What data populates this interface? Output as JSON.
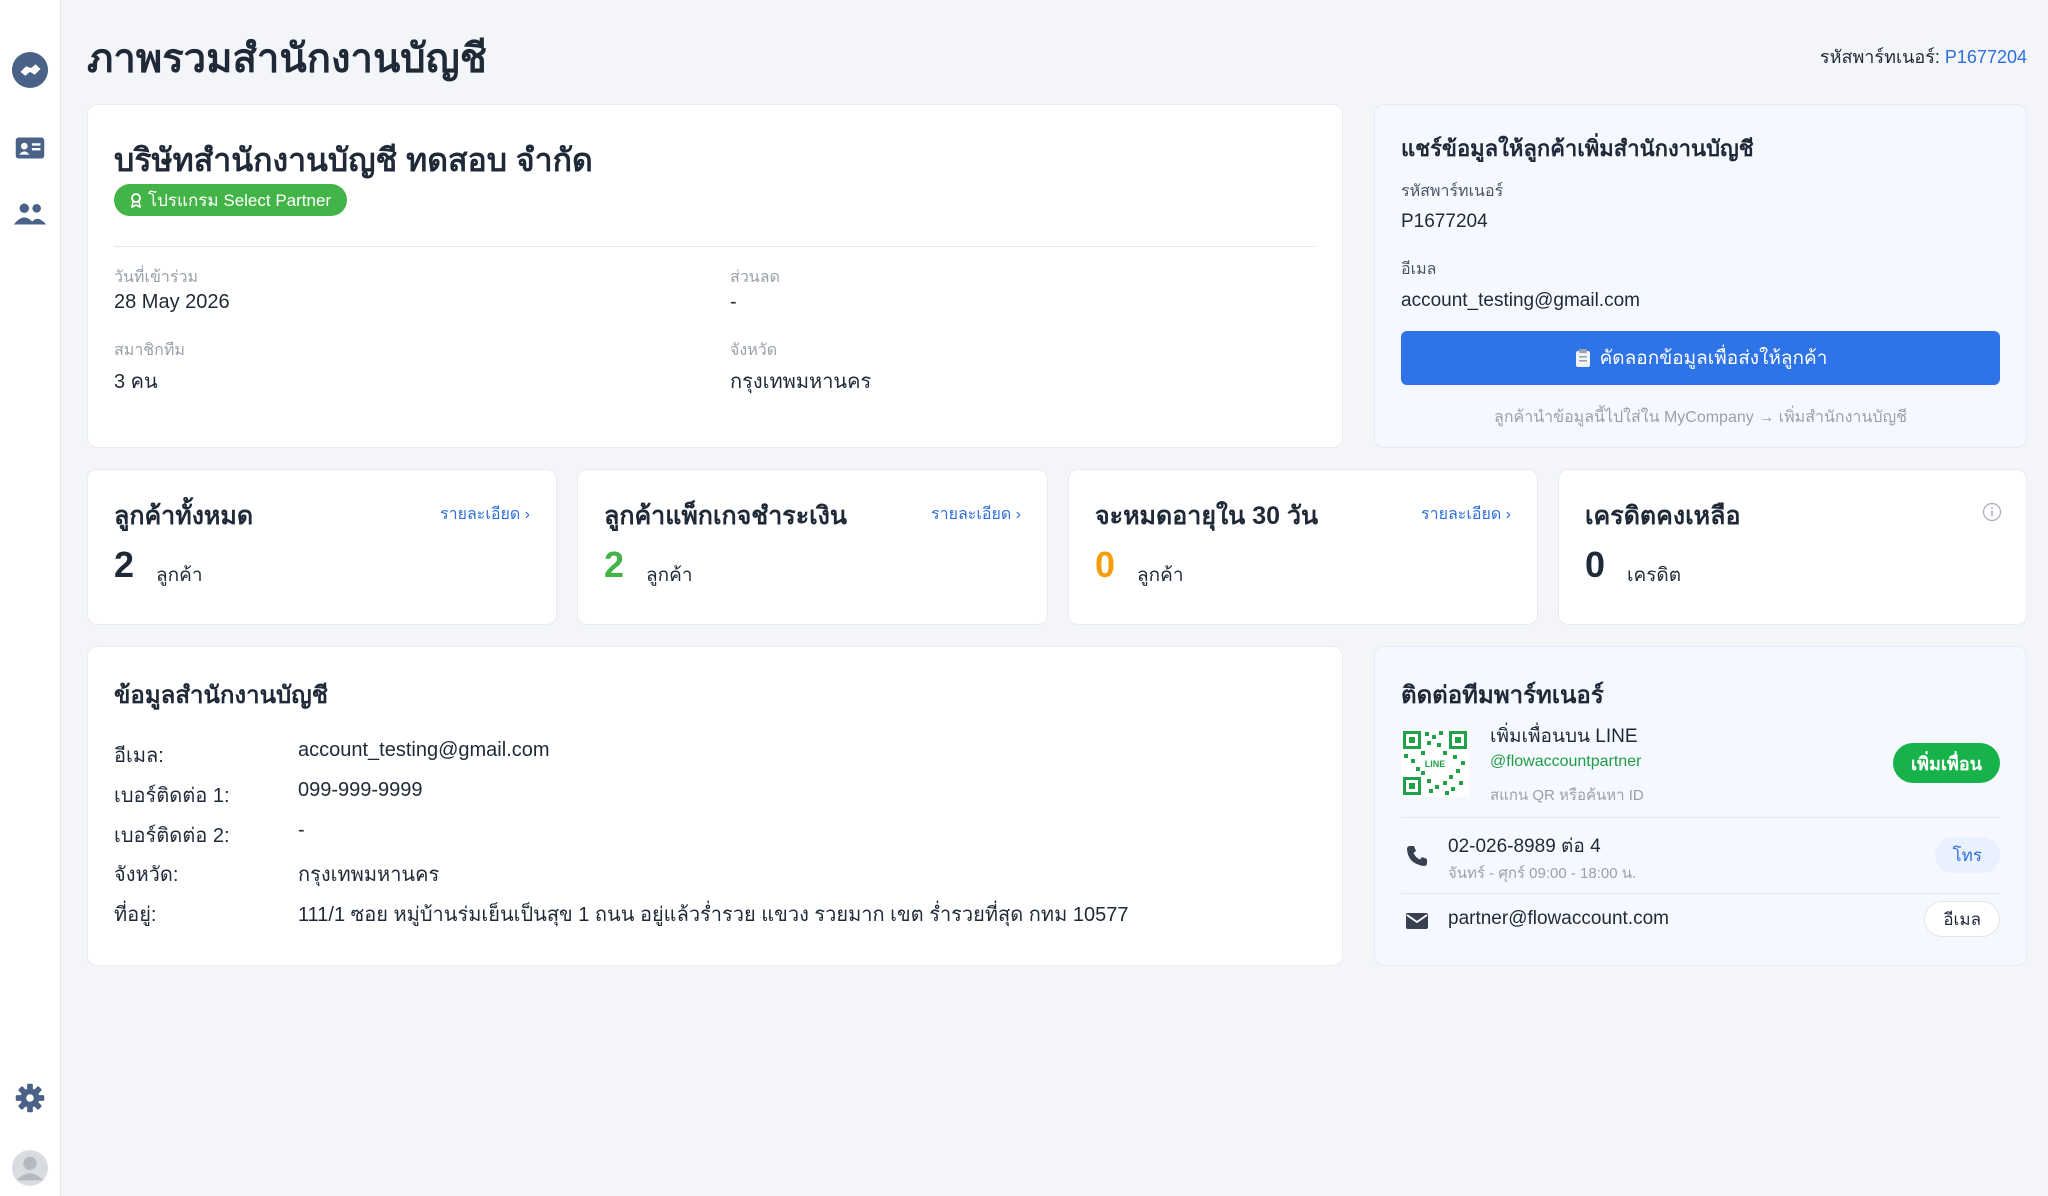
{
  "sidebar": {
    "items": [
      {
        "icon": "handshake-icon"
      },
      {
        "icon": "contact-card-icon"
      },
      {
        "icon": "users-icon"
      }
    ],
    "bottom": [
      {
        "icon": "gear-icon"
      },
      {
        "icon": "avatar-icon"
      }
    ]
  },
  "header": {
    "title": "ภาพรวมสำนักงานบัญชี",
    "partner_label": "รหัสพาร์ทเนอร์:",
    "partner_id": "P1677204"
  },
  "company": {
    "name": "บริษัทสำนักงานบัญชี ทดสอบ จำกัด",
    "badge": "โปรแกรม Select Partner",
    "join_label": "วันที่เข้าร่วม",
    "join_value": "28 May 2026",
    "discount_label": "ส่วนลด",
    "discount_value": "-",
    "members_label": "สมาชิกทีม",
    "members_value": "3 คน",
    "province_label": "จังหวัด",
    "province_value": "กรุงเทพมหานคร"
  },
  "share": {
    "title": "แชร์ข้อมูลให้ลูกค้าเพิ่มสำนักงานบัญชี",
    "partner_label": "รหัสพาร์ทเนอร์",
    "partner_value": "P1677204",
    "email_label": "อีเมล",
    "email_value": "account_testing@gmail.com",
    "copy_button": "คัดลอกข้อมูลเพื่อส่งให้ลูกค้า",
    "hint": "ลูกค้านำข้อมูลนี้ไปใส่ใน MyCompany → เพิ่มสำนักงานบัญชี"
  },
  "stats": [
    {
      "title": "ลูกค้าทั้งหมด",
      "link": "รายละเอียด ›",
      "value": "2",
      "unit": "ลูกค้า",
      "color": "#1f2937"
    },
    {
      "title": "ลูกค้าแพ็กเกจชำระเงิน",
      "link": "รายละเอียด ›",
      "value": "2",
      "unit": "ลูกค้า",
      "color": "#43b447"
    },
    {
      "title": "จะหมดอายุใน 30 วัน",
      "link": "รายละเอียด ›",
      "value": "0",
      "unit": "ลูกค้า",
      "color": "#f59e0b"
    },
    {
      "title": "เครดิตคงเหลือ",
      "link": "",
      "value": "0",
      "unit": "เครดิต",
      "color": "#1f2937"
    }
  ],
  "office": {
    "title": "ข้อมูลสำนักงานบัญชี",
    "rows": [
      {
        "label": "อีเมล:",
        "value": "account_testing@gmail.com"
      },
      {
        "label": "เบอร์ติดต่อ 1:",
        "value": "099-999-9999"
      },
      {
        "label": "เบอร์ติดต่อ 2:",
        "value": "-"
      },
      {
        "label": "จังหวัด:",
        "value": "กรุงเทพมหานคร"
      },
      {
        "label": "ที่อยู่:",
        "value": "111/1 ซอย หมู่บ้านร่มเย็นเป็นสุข 1 ถนน อยู่แล้วร่ำรวย แขวง รวยมาก เขต ร่ำรวยที่สุด กทม 10577"
      }
    ]
  },
  "contact": {
    "title": "ติดต่อทีมพาร์ทเนอร์",
    "line_title": "เพิ่มเพื่อนบน LINE",
    "line_id": "@flowaccountpartner",
    "line_hint": "สแกน QR หรือค้นหา ID",
    "add_button": "เพิ่มเพื่อน",
    "qr_text": "LINE",
    "phone": "02-026-8989 ต่อ 4",
    "phone_hours": "จันทร์ - ศุกร์ 09:00 - 18:00 น.",
    "call_button": "โทร",
    "email": "partner@flowaccount.com",
    "email_button": "อีเมล"
  },
  "colors": {
    "accent": "#2f73e8",
    "green": "#43b447",
    "line_green": "#17b34a",
    "orange": "#f59e0b"
  }
}
